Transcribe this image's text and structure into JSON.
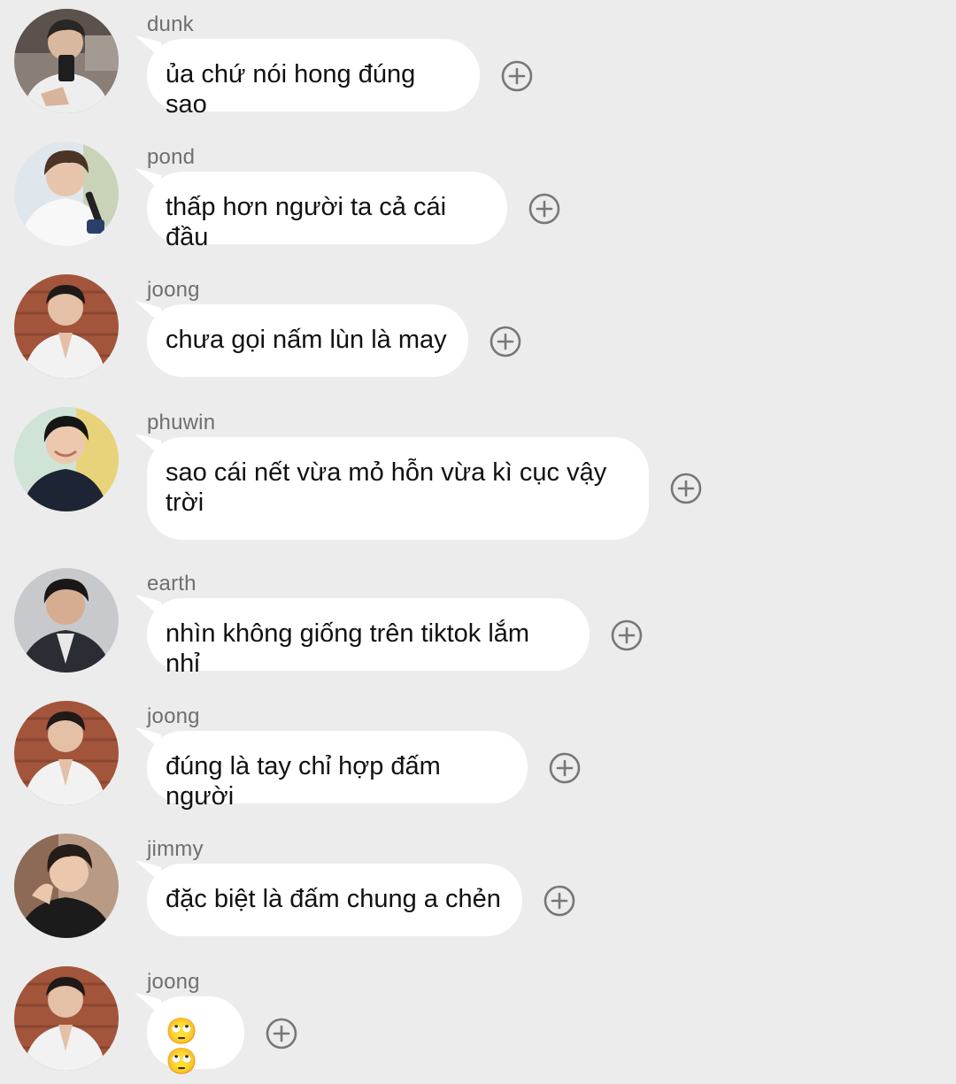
{
  "colors": {
    "background": "#ececec",
    "bubble": "#ffffff",
    "sender_text": "#6f6f6f",
    "message_text": "#111111",
    "plus_icon": "#777777"
  },
  "messages": [
    {
      "sender": "dunk",
      "text": "ủa chứ nói hong đúng sao",
      "avatar_icon": "avatar-photo-icon",
      "react_icon": "add-reaction-icon"
    },
    {
      "sender": "pond",
      "text": "thấp hơn người ta cả cái đầu",
      "avatar_icon": "avatar-photo-icon",
      "react_icon": "add-reaction-icon"
    },
    {
      "sender": "joong",
      "text": "chưa gọi nấm lùn là may",
      "avatar_icon": "avatar-photo-icon",
      "react_icon": "add-reaction-icon"
    },
    {
      "sender": "phuwin",
      "text": "sao cái nết vừa mỏ hỗn vừa kì cục vậy trời",
      "avatar_icon": "avatar-photo-icon",
      "react_icon": "add-reaction-icon"
    },
    {
      "sender": "earth",
      "text": "nhìn không giống trên tiktok lắm nhỉ",
      "avatar_icon": "avatar-photo-icon",
      "react_icon": "add-reaction-icon"
    },
    {
      "sender": "joong",
      "text": "đúng là tay chỉ hợp đấm người",
      "avatar_icon": "avatar-photo-icon",
      "react_icon": "add-reaction-icon"
    },
    {
      "sender": "jimmy",
      "text": "đặc biệt là đấm chung a chẻn",
      "avatar_icon": "avatar-photo-icon",
      "react_icon": "add-reaction-icon"
    },
    {
      "sender": "joong",
      "text": "🙄🙄",
      "avatar_icon": "avatar-photo-icon",
      "react_icon": "add-reaction-icon"
    }
  ]
}
